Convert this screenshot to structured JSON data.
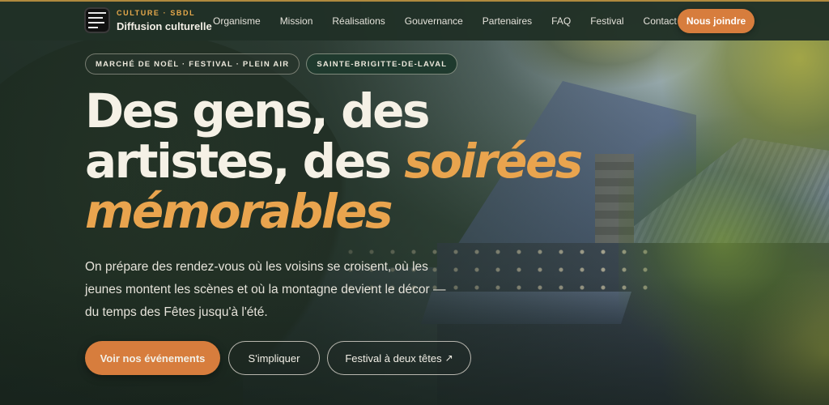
{
  "brand": {
    "kicker": "CULTURE · SBDL",
    "title": "Diffusion culturelle",
    "logo_icon": "diffusion-culturelle-logo"
  },
  "nav": {
    "items": [
      "Organisme",
      "Mission",
      "Réalisations",
      "Gouvernance",
      "Partenaires",
      "FAQ",
      "Festival",
      "Contact"
    ],
    "cta": "Nous joindre"
  },
  "hero": {
    "tags": [
      "MARCHÉ DE NOËL · FESTIVAL · PLEIN AIR",
      "SAINTE-BRIGITTE-DE-LAVAL"
    ],
    "headline_line1": "Des gens, des",
    "headline_line2": "artistes, des ",
    "headline_accent1": "soirées",
    "headline_accent2": "mémorables",
    "lede": "On prépare des rendez-vous où les voisins se croisent, où les jeunes montent les scènes et où la montagne devient le décor — du temps des Fêtes jusqu'à l'été.",
    "buttons": {
      "primary": "Voir nos événements",
      "secondary": "S'impliquer",
      "festival": "Festival à deux têtes",
      "festival_icon": "arrow-up-right-icon"
    }
  },
  "colors": {
    "accent": "#d77d3d",
    "headline_accent": "#e9a44e",
    "nav_bg": "#203026",
    "kicker": "#e7a94b"
  }
}
